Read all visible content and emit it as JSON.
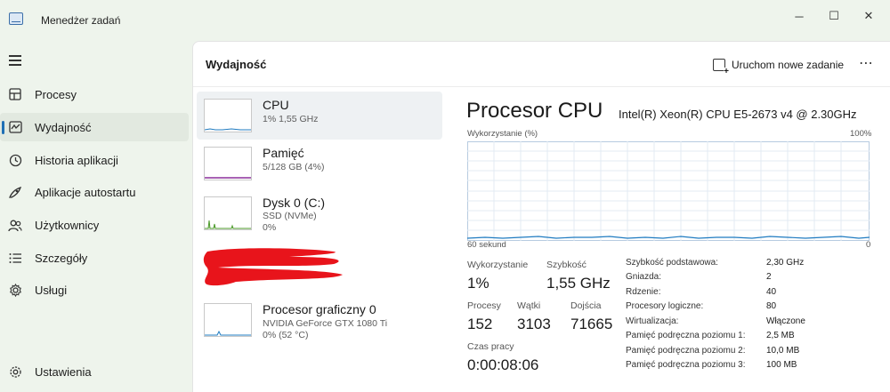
{
  "window": {
    "title": "Menedżer zadań",
    "controls": {
      "minimize": "─",
      "maximize": "☐",
      "close": "✕"
    }
  },
  "sidebar": {
    "items": [
      {
        "label": "Procesy",
        "icon": "grid-icon",
        "active": false
      },
      {
        "label": "Wydajność",
        "icon": "performance-icon",
        "active": true
      },
      {
        "label": "Historia aplikacji",
        "icon": "history-icon",
        "active": false
      },
      {
        "label": "Aplikacje autostartu",
        "icon": "startup-icon",
        "active": false
      },
      {
        "label": "Użytkownicy",
        "icon": "users-icon",
        "active": false
      },
      {
        "label": "Szczegóły",
        "icon": "details-icon",
        "active": false
      },
      {
        "label": "Usługi",
        "icon": "services-icon",
        "active": false
      }
    ],
    "settings_label": "Ustawienia"
  },
  "header": {
    "title": "Wydajność",
    "run_task_label": "Uruchom nowe zadanie",
    "more_label": "⋯"
  },
  "resources": [
    {
      "name": "CPU",
      "sub1": "1% 1,55 GHz",
      "sub2": "",
      "selected": true,
      "graph_color": "#1f7bc1"
    },
    {
      "name": "Pamięć",
      "sub1": "5/128 GB (4%)",
      "sub2": "",
      "selected": false,
      "graph_color": "#8b2f9c"
    },
    {
      "name": "Dysk 0 (C:)",
      "sub1": "SSD (NVMe)",
      "sub2": "0%",
      "selected": false,
      "graph_color": "#4c9a2a"
    },
    {
      "name": "Procesor graficzny 0",
      "sub1": "NVIDIA GeForce GTX 1080 Ti",
      "sub2": "0%  (52 °C)",
      "selected": false,
      "graph_color": "#1f7bc1"
    }
  ],
  "detail": {
    "title": "Procesor CPU",
    "model": "Intel(R) Xeon(R) CPU E5-2673 v4 @ 2.30GHz",
    "graph": {
      "top_left": "Wykorzystanie (%)",
      "top_right": "100%",
      "bottom_left": "60 sekund",
      "bottom_right": "0",
      "line_color": "#1f7bc1"
    },
    "stats": {
      "usage_label": "Wykorzystanie",
      "usage_value": "1%",
      "speed_label": "Szybkość",
      "speed_value": "1,55 GHz",
      "processes_label": "Procesy",
      "processes_value": "152",
      "threads_label": "Wątki",
      "threads_value": "3103",
      "handles_label": "Dojścia",
      "handles_value": "71665",
      "uptime_label": "Czas pracy",
      "uptime_value": "0:00:08:06"
    },
    "specs": [
      {
        "key": "Szybkość podstawowa:",
        "value": "2,30 GHz"
      },
      {
        "key": "Gniazda:",
        "value": "2"
      },
      {
        "key": "Rdzenie:",
        "value": "40"
      },
      {
        "key": "Procesory logiczne:",
        "value": "80"
      },
      {
        "key": "Wirtualizacja:",
        "value": "Włączone"
      },
      {
        "key": "Pamięć podręczna poziomu 1:",
        "value": "2,5 MB"
      },
      {
        "key": "Pamięć podręczna poziomu 2:",
        "value": "10,0 MB"
      },
      {
        "key": "Pamięć podręczna poziomu 3:",
        "value": "100 MB"
      }
    ]
  },
  "colors": {
    "accent": "#1f6fb5",
    "redaction": "#e8141b"
  }
}
